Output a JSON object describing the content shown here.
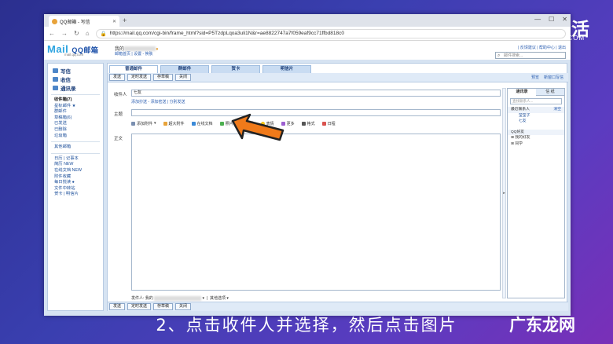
{
  "browser": {
    "tab_title": "QQ邮箱 - 写信",
    "new_tab": "+",
    "url": "https://mail.qq.com/cgi-bin/frame_html?sid=P5TzdpLqoa3uli1N&r=ae8822747a7f059eaf9cc71ffbd818c0",
    "win_min": "—",
    "win_max": "☐",
    "win_close": "✕",
    "nav_back": "←",
    "nav_fwd": "→",
    "nav_reload": "↻",
    "nav_home": "⌂"
  },
  "mail_header": {
    "logo_main": "Mail",
    "logo_cn": "QQ邮箱",
    "logo_sub": "mail.qq.com",
    "user_prefix": "我的",
    "user_links": "邮箱首页 | 设置 - 换肤",
    "top_links": "| 反馈建议 | 帮助中心 | 退出",
    "search_placeholder": "邮件搜索..."
  },
  "leftnav": {
    "primary": [
      {
        "label": "写信",
        "icon": "pen-icon"
      },
      {
        "label": "收信",
        "icon": "inbox-icon"
      },
      {
        "label": "通讯录",
        "icon": "addressbook-icon"
      }
    ],
    "folders": [
      {
        "label": "收件箱(7)",
        "bold": true
      },
      {
        "label": "星标邮件 ★",
        "bold": false
      },
      {
        "label": "群邮件",
        "bold": false
      },
      {
        "label": "草稿箱(6)",
        "bold": false
      },
      {
        "label": "已发送",
        "bold": false
      },
      {
        "label": "已删除",
        "bold": false
      },
      {
        "label": "垃圾箱",
        "bold": false
      }
    ],
    "other_title": "其他邮箱",
    "apps": [
      "日历 | 记事本",
      "简历 NEW",
      "在线文档 NEW",
      "附件收藏",
      "每日悦读 ●",
      "文件中转站",
      "贺卡 | 明信片"
    ]
  },
  "compose": {
    "tabs": [
      "普通邮件",
      "群邮件",
      "贺卡",
      "明信片"
    ],
    "toolbar_buttons": [
      "发送",
      "定时发送",
      "存草稿",
      "关闭"
    ],
    "toolbar_right": [
      "预览",
      "新窗口写信"
    ],
    "to_label": "收件人",
    "to_value": "七友",
    "to_actions": "添加抄送 - 添加密送 | 分别发送",
    "subject_label": "主题",
    "format_items": [
      "添加附件",
      "超大附件",
      "在线文档",
      "照片",
      "截屏",
      "表情",
      "更多",
      "格式",
      "日程"
    ],
    "body_label": "正文",
    "sender_label": "发件人: 我的",
    "sender_other": "其他选项 ▾"
  },
  "contacts": {
    "tabs": [
      "通讯录",
      "信 纸"
    ],
    "search_placeholder": "查找联系人...",
    "recent_title": "最近联系人",
    "clear": "清空",
    "recent": [
      "莹莹子",
      "七友"
    ],
    "group_title": "QQ好友",
    "groups": [
      "⊞ 我的好友",
      "⊞ 同学"
    ]
  },
  "overlay": {
    "brand_name": "懂视生活",
    "brand_sub": "51DONGSHI.COM",
    "caption": "2、点击收件人并选择，然后点击图片",
    "watermark": "广东龙网"
  },
  "colors": {
    "accent": "#f07a1a",
    "link": "#2a5db0"
  }
}
